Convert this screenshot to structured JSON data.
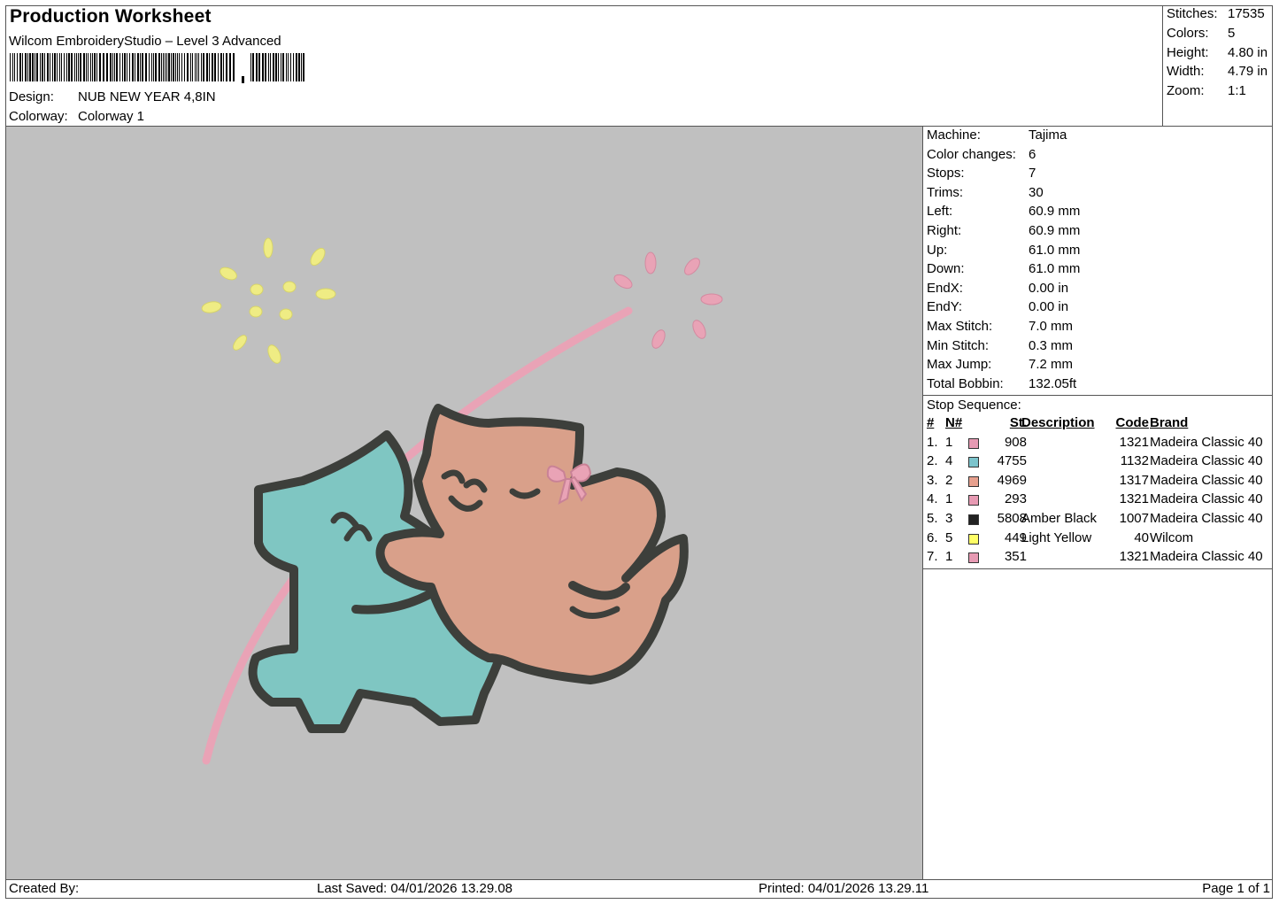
{
  "header": {
    "title": "Production Worksheet",
    "software": "Wilcom EmbroideryStudio – Level 3 Advanced",
    "design_label": "Design:",
    "design_value": "NUB NEW YEAR 4,8IN",
    "colorway_label": "Colorway:",
    "colorway_value": "Colorway 1"
  },
  "stats": [
    {
      "label": "Stitches:",
      "value": "17535"
    },
    {
      "label": "Colors:",
      "value": "5"
    },
    {
      "label": "Height:",
      "value": "4.80 in"
    },
    {
      "label": "Width:",
      "value": "4.79 in"
    },
    {
      "label": "Zoom:",
      "value": "1:1"
    }
  ],
  "machine_info": [
    {
      "label": "Machine:",
      "value": "Tajima"
    },
    {
      "label": "Color changes:",
      "value": "6"
    },
    {
      "label": "Stops:",
      "value": "7"
    },
    {
      "label": "Trims:",
      "value": "30"
    },
    {
      "label": "Left:",
      "value": "60.9 mm"
    },
    {
      "label": "Right:",
      "value": "60.9 mm"
    },
    {
      "label": "Up:",
      "value": "61.0 mm"
    },
    {
      "label": "Down:",
      "value": "61.0 mm"
    },
    {
      "label": "EndX:",
      "value": "0.00 in"
    },
    {
      "label": "EndY:",
      "value": "0.00 in"
    },
    {
      "label": "Max Stitch:",
      "value": "7.0 mm"
    },
    {
      "label": "Min Stitch:",
      "value": "0.3 mm"
    },
    {
      "label": "Max Jump:",
      "value": "7.2 mm"
    },
    {
      "label": "Total Bobbin:",
      "value": "132.05ft"
    }
  ],
  "stop_sequence": {
    "title": "Stop Sequence:",
    "headers": {
      "idx": "#",
      "n": "N#",
      "st": "St.",
      "desc": "Description",
      "code": "Code",
      "brand": "Brand"
    },
    "rows": [
      {
        "idx": "1.",
        "n": "1",
        "color": "#e79ab3",
        "st": "908",
        "desc": "",
        "code": "1321",
        "brand": "Madeira Classic 40"
      },
      {
        "idx": "2.",
        "n": "4",
        "color": "#7cc4cc",
        "st": "4755",
        "desc": "",
        "code": "1132",
        "brand": "Madeira Classic 40"
      },
      {
        "idx": "3.",
        "n": "2",
        "color": "#e7a08e",
        "st": "4969",
        "desc": "",
        "code": "1317",
        "brand": "Madeira Classic 40"
      },
      {
        "idx": "4.",
        "n": "1",
        "color": "#e79ab3",
        "st": "293",
        "desc": "",
        "code": "1321",
        "brand": "Madeira Classic 40"
      },
      {
        "idx": "5.",
        "n": "3",
        "color": "#222222",
        "st": "5808",
        "desc": "Amber Black",
        "code": "1007",
        "brand": "Madeira Classic 40"
      },
      {
        "idx": "6.",
        "n": "5",
        "color": "#ffff66",
        "st": "449",
        "desc": "Light Yellow",
        "code": "40",
        "brand": "Wilcom"
      },
      {
        "idx": "7.",
        "n": "1",
        "color": "#e79ab3",
        "st": "351",
        "desc": "",
        "code": "1321",
        "brand": "Madeira Classic 40"
      }
    ]
  },
  "footer": {
    "created_by": "Created By:",
    "last_saved": "Last Saved: 04/01/2026 13.29.08",
    "printed": "Printed: 04/01/2026 13.29.11",
    "page": "Page 1 of 1"
  },
  "colors": {
    "canvas_bg": "#c0c0c0",
    "teal_fill": "#7fc6c2",
    "peach_fill": "#d9a08a",
    "outline": "#3d3f3b",
    "pink": "#e9a3b6",
    "yellow": "#efec84"
  }
}
